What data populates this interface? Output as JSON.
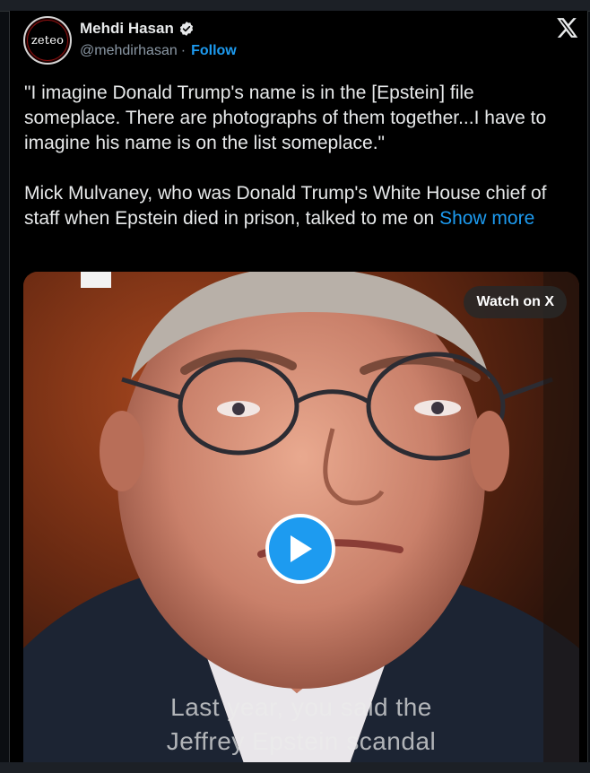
{
  "author": {
    "display_name": "Mehdi Hasan",
    "handle": "@mehdirhasan",
    "separator": "·",
    "follow_label": "Follow",
    "avatar_text": "zeteo"
  },
  "tweet": {
    "paragraph1": "\"I imagine Donald Trump's name is in the [Epstein] file someplace. There are photographs of them together...I have to imagine his name is on the list someplace.\"",
    "paragraph2": "Mick Mulvaney, who was Donald Trump's White House chief of staff when Epstein died in prison, talked to me on ",
    "show_more_label": "Show more"
  },
  "media": {
    "watch_label": "Watch on X",
    "caption_line1": "Last year, you said the",
    "caption_line2": "Jeffrey Epstein scandal"
  },
  "colors": {
    "accent": "#1d9bf0",
    "background": "#000000",
    "text": "#e7e9ea",
    "muted": "#8b98a5"
  },
  "icons": [
    "verified-badge-icon",
    "x-logo-icon",
    "play-icon"
  ]
}
